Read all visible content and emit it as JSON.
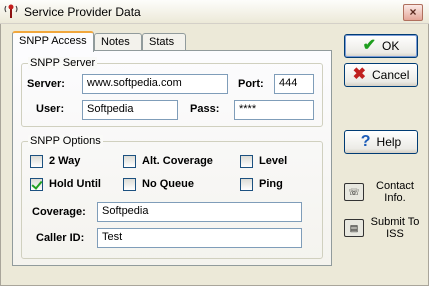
{
  "window": {
    "title": "Service Provider Data",
    "close_glyph": "×"
  },
  "tabs": [
    {
      "label": "SNPP Access"
    },
    {
      "label": "Notes"
    },
    {
      "label": "Stats"
    }
  ],
  "snpp_server": {
    "group_title": "SNPP Server",
    "server_label": "Server:",
    "server_value": "www.softpedia.com",
    "port_label": "Port:",
    "port_value": "444",
    "user_label": "User:",
    "user_value": "Softpedia",
    "pass_label": "Pass:",
    "pass_value": "****"
  },
  "snpp_options": {
    "group_title": "SNPP Options",
    "checkboxes": [
      {
        "label": "2 Way",
        "checked": false
      },
      {
        "label": "Alt. Coverage",
        "checked": false
      },
      {
        "label": "Level",
        "checked": false
      },
      {
        "label": "Hold Until",
        "checked": true
      },
      {
        "label": "No Queue",
        "checked": false
      },
      {
        "label": "Ping",
        "checked": false
      }
    ],
    "coverage_label": "Coverage:",
    "coverage_value": "Softpedia",
    "caller_id_label": "Caller ID:",
    "caller_id_value": "Test"
  },
  "buttons": {
    "ok_label": "OK",
    "cancel_label": "Cancel",
    "help_label": "Help"
  },
  "side_actions": {
    "contact_label": "Contact Info.",
    "submit_label": "Submit To ISS"
  },
  "colors": {
    "ok_check": "#1E9E1E",
    "cancel_x": "#C0201F",
    "help_q": "#1C5CB8",
    "tab_accent": "#F1A73C"
  }
}
